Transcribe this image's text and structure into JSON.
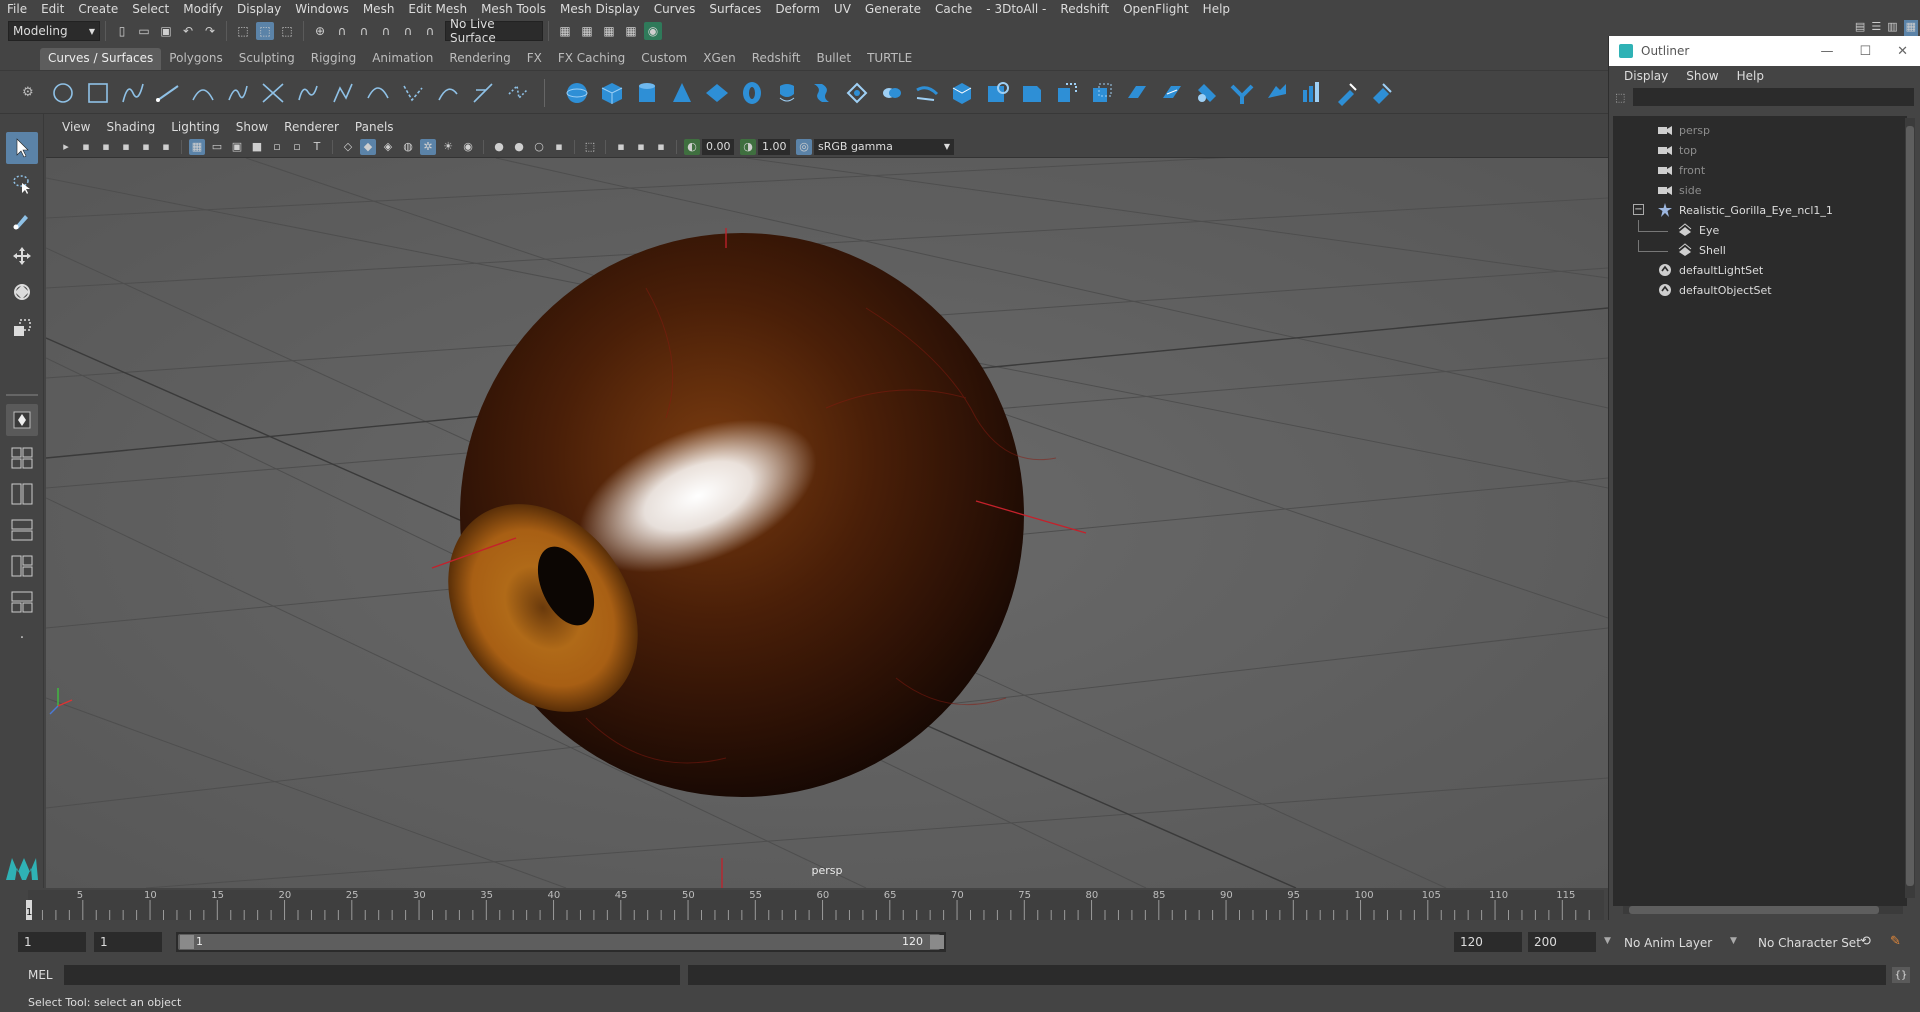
{
  "menubar": {
    "items": [
      "File",
      "Edit",
      "Create",
      "Select",
      "Modify",
      "Display",
      "Windows",
      "Mesh",
      "Edit Mesh",
      "Mesh Tools",
      "Mesh Display",
      "Curves",
      "Surfaces",
      "Deform",
      "UV",
      "Generate",
      "Cache",
      "- 3DtoAll -",
      "Redshift",
      "OpenFlight",
      "Help"
    ]
  },
  "statusline": {
    "mode": "Modeling",
    "live_surface": "No Live Surface"
  },
  "shelf": {
    "tabs": [
      "Curves / Surfaces",
      "Polygons",
      "Sculpting",
      "Rigging",
      "Animation",
      "Rendering",
      "FX",
      "FX Caching",
      "Custom",
      "XGen",
      "Redshift",
      "Bullet",
      "TURTLE"
    ],
    "active_tab": "Curves / Surfaces"
  },
  "viewport": {
    "menus": [
      "View",
      "Shading",
      "Lighting",
      "Show",
      "Renderer",
      "Panels"
    ],
    "exposure": "0.00",
    "gamma": "1.00",
    "color_space": "sRGB gamma",
    "camera_label": "persp"
  },
  "outliner": {
    "title": "Outliner",
    "menus": [
      "Display",
      "Show",
      "Help"
    ],
    "items": [
      {
        "label": "persp",
        "kind": "camera",
        "dim": true
      },
      {
        "label": "top",
        "kind": "camera",
        "dim": true
      },
      {
        "label": "front",
        "kind": "camera",
        "dim": true
      },
      {
        "label": "side",
        "kind": "camera",
        "dim": true
      },
      {
        "label": "Realistic_Gorilla_Eye_ncl1_1",
        "kind": "group",
        "dim": false
      },
      {
        "label": "Eye",
        "kind": "mesh",
        "dim": false
      },
      {
        "label": "Shell",
        "kind": "mesh",
        "dim": false
      },
      {
        "label": "defaultLightSet",
        "kind": "set",
        "dim": false
      },
      {
        "label": "defaultObjectSet",
        "kind": "set",
        "dim": false
      }
    ]
  },
  "timeslider": {
    "current_frame": "1",
    "ticks": [
      "5",
      "10",
      "15",
      "20",
      "25",
      "30",
      "35",
      "40",
      "45",
      "50",
      "55",
      "60",
      "65",
      "70",
      "75",
      "80",
      "85",
      "90",
      "95",
      "100",
      "105",
      "110",
      "115"
    ]
  },
  "range": {
    "start": "1",
    "playback_start": "1",
    "slider_start": "1",
    "slider_end": "120",
    "playback_end": "120",
    "end": "200",
    "anim_layer": "No Anim Layer",
    "character_set": "No Character Set"
  },
  "commandline": {
    "language": "MEL"
  },
  "helpline": {
    "text": "Select Tool: select an object"
  },
  "colors": {
    "ui_bg": "#444444",
    "field_bg": "#2b2b2b",
    "accent": "#5b83a8",
    "viewport_bg": "#5e5e5e"
  }
}
